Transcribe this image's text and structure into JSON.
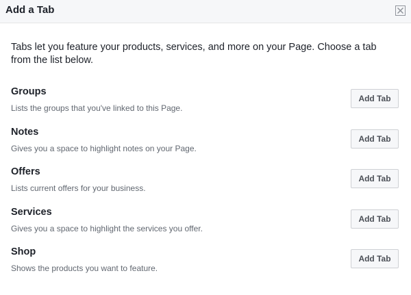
{
  "dialog": {
    "title": "Add a Tab",
    "close_icon": "close-icon",
    "intro": "Tabs let you feature your products, services, and more on your Page. Choose a tab from the list below."
  },
  "tabs": [
    {
      "name": "Groups",
      "description": "Lists the groups that you've linked to this Page.",
      "button_label": "Add Tab"
    },
    {
      "name": "Notes",
      "description": "Gives you a space to highlight notes on your Page.",
      "button_label": "Add Tab"
    },
    {
      "name": "Offers",
      "description": "Lists current offers for your business.",
      "button_label": "Add Tab"
    },
    {
      "name": "Services",
      "description": "Gives you a space to highlight the services you offer.",
      "button_label": "Add Tab"
    },
    {
      "name": "Shop",
      "description": "Shows the products you want to feature.",
      "button_label": "Add Tab"
    }
  ],
  "colors": {
    "header_bg": "#f6f7f9",
    "text_primary": "#1d2129",
    "text_secondary": "#616770",
    "button_bg": "#f6f7f9",
    "button_border": "#ced0d4",
    "close_icon": "#90949c"
  }
}
